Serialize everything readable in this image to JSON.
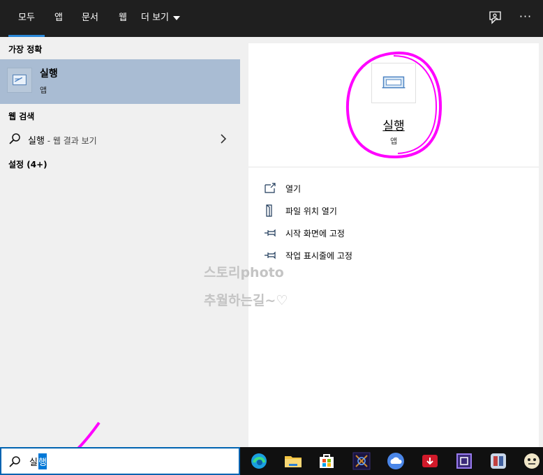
{
  "tabs": [
    {
      "label": "모두"
    },
    {
      "label": "앱"
    },
    {
      "label": "문서"
    },
    {
      "label": "웹"
    },
    {
      "label": "더 보기"
    }
  ],
  "more_icon": "···",
  "sections": {
    "best_match": "가장 정확",
    "web_search": "웹 검색",
    "settings": "설정 (4+)"
  },
  "best_match": {
    "title": "실행",
    "subtitle": "앱",
    "icon": "run-app-icon"
  },
  "web_result": {
    "query": "실행",
    "suffix": " - 웹 결과 보기"
  },
  "preview": {
    "title": "실행",
    "subtitle": "앱"
  },
  "actions": [
    {
      "label": "열기",
      "icon": "open-icon"
    },
    {
      "label": "파일 위치 열기",
      "icon": "file-location-icon"
    },
    {
      "label": "시작 화면에 고정",
      "icon": "pin-icon"
    },
    {
      "label": "작업 표시줄에 고정",
      "icon": "pin-icon"
    }
  ],
  "watermark": {
    "line1": "스토리photo",
    "line2": "추월하는길~♡"
  },
  "search": {
    "prefix": "실",
    "selected": "행"
  },
  "taskbar": [
    "edge-icon",
    "file-explorer-icon",
    "store-icon",
    "app-icon",
    "cloud-icon",
    "download-icon",
    "chip-icon",
    "photo-app-icon",
    "game-icon"
  ],
  "colors": {
    "accent": "#0078d7",
    "tab_underline": "#2b88d8",
    "selected_bg": "#a9bcd3",
    "annotation": "#ff00ff"
  }
}
